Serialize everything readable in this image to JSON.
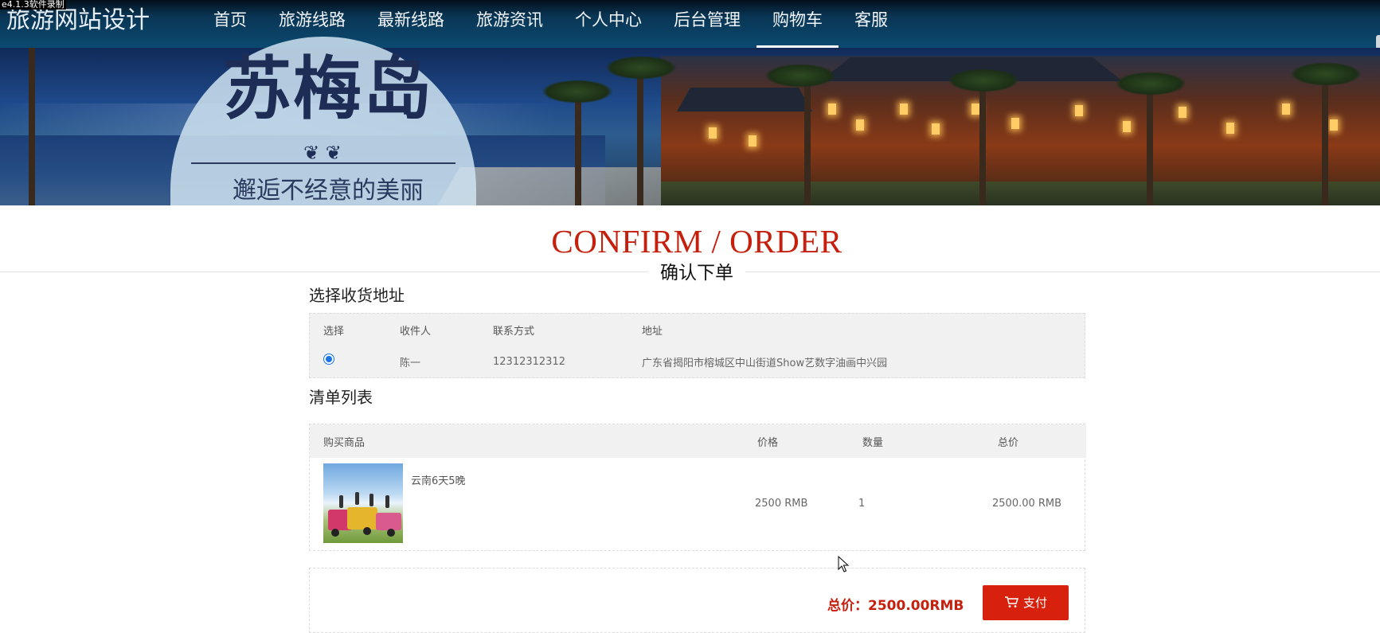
{
  "watermark": "e4.1.3软件录制",
  "header": {
    "logo": "旅游网站设计",
    "nav": [
      "首页",
      "旅游线路",
      "最新线路",
      "旅游资讯",
      "个人中心",
      "后台管理",
      "购物车",
      "客服"
    ],
    "active_nav": "购物车"
  },
  "banner": {
    "title": "苏梅岛",
    "ornament": "❦ ❦",
    "subtitle": "邂逅不经意的美丽"
  },
  "page": {
    "title_en": "CONFIRM / ORDER",
    "title_cn": "确认下单"
  },
  "address_section": {
    "label": "选择收货地址",
    "columns": [
      "选择",
      "收件人",
      "联系方式",
      "地址"
    ],
    "rows": [
      {
        "selected": true,
        "recipient": "陈一",
        "phone": "12312312312",
        "address": "广东省揭阳市榕城区中山街道Show艺数字油画中兴园"
      }
    ]
  },
  "list_section": {
    "label": "清单列表",
    "columns": [
      "购买商品",
      "价格",
      "数量",
      "总价"
    ],
    "items": [
      {
        "name": "云南6天5晚",
        "price": "2500 RMB",
        "qty": "1",
        "total": "2500.00 RMB"
      }
    ]
  },
  "footer": {
    "total_label": "总价：2500.00RMB",
    "pay_button": "支付"
  },
  "colors": {
    "accent_red": "#c51f0e",
    "nav_bg": "#0b4a70"
  }
}
